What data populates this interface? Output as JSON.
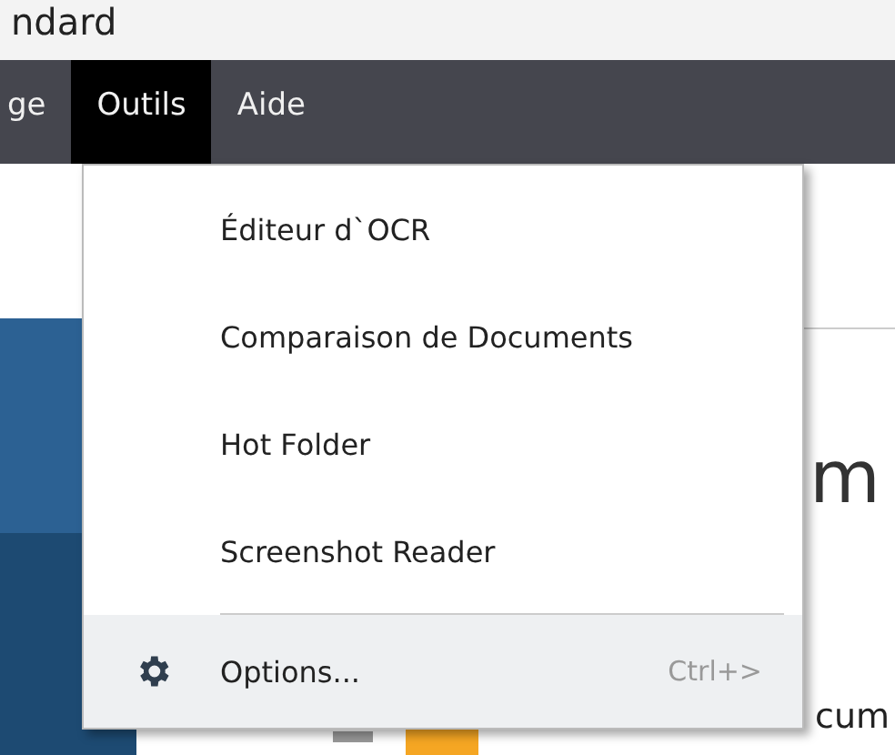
{
  "window": {
    "title": "ndard"
  },
  "menu_bar": [
    {
      "label": "ge",
      "selected": false
    },
    {
      "label": "Outils",
      "selected": true
    },
    {
      "label": "Aide",
      "selected": false
    }
  ],
  "dropdown": {
    "items": [
      {
        "kind": "item",
        "label": "Éditeur d`OCR",
        "highlighted": false
      },
      {
        "kind": "item",
        "label": "Comparaison de Documents",
        "highlighted": false
      },
      {
        "kind": "item",
        "label": "Hot Folder",
        "highlighted": false
      },
      {
        "kind": "item",
        "label": "Screenshot Reader",
        "highlighted": false
      },
      {
        "kind": "separator"
      },
      {
        "kind": "settings_item",
        "label": "Options...",
        "shortcut": "Ctrl+>",
        "highlighted": true
      }
    ]
  },
  "content": {
    "heading": "m",
    "text": "cum"
  }
}
